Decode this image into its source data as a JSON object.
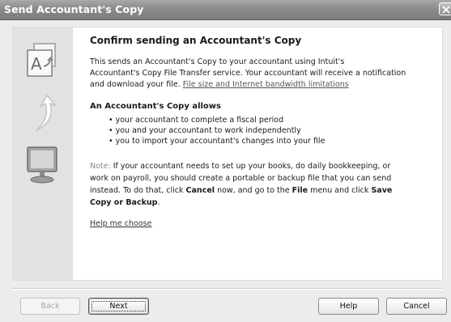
{
  "window": {
    "title": "Send Accountant's Copy"
  },
  "content": {
    "heading": "Confirm sending an Accountant's Copy",
    "intro_line1": "This sends an Accountant's Copy to your accountant using Intuit's",
    "intro_line2": "Accountant's Copy File Transfer service. Your accountant will receive a notification",
    "intro_line3": "and download your file.",
    "intro_link": "File size and Internet bandwidth limitations",
    "allows_heading": "An Accountant's Copy allows",
    "bullets": [
      "your accountant to complete a fiscal period",
      "you and your accountant to work independently",
      "you to import your accountant's changes into your file"
    ],
    "note_label": "Note:",
    "note_line1": "If your accountant needs to set up your books, do daily bookkeeping, or",
    "note_line2": "work on payroll, you should create a portable or backup file that you can send",
    "note_line3a": "instead. To do that, click",
    "note_cancel": "Cancel",
    "note_line3b": "now, and go to the",
    "note_file": "File",
    "note_line3c": "menu and click",
    "note_save": "Save",
    "note_line4": "Copy or Backup",
    "note_period": ".",
    "help_link": "Help me choose"
  },
  "buttons": {
    "back": "Back",
    "next": "Next",
    "help": "Help",
    "cancel": "Cancel"
  },
  "icons": [
    "accountant-copy-icon",
    "arrow-icon",
    "monitor-icon",
    "close-icon"
  ]
}
